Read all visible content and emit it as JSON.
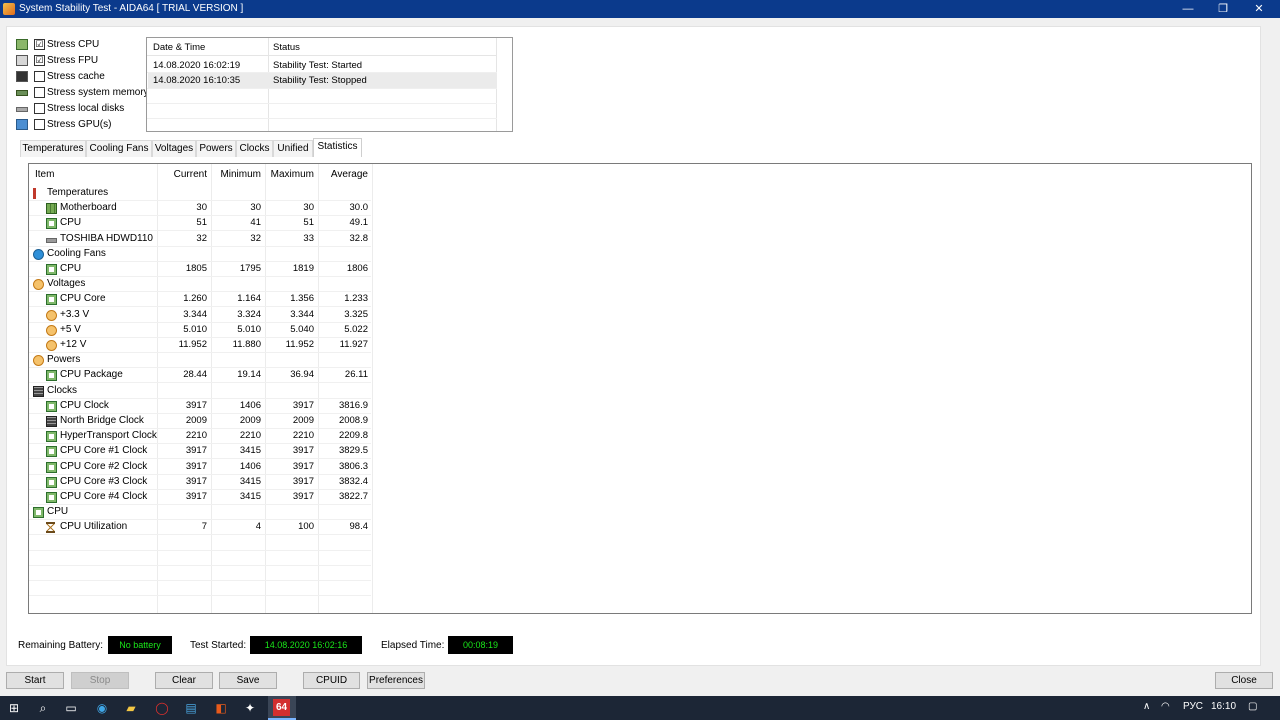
{
  "window": {
    "title": "System Stability Test - AIDA64  [ TRIAL VERSION ]",
    "minimize": "—",
    "maximize": "❐",
    "close": "✕"
  },
  "stress_options": [
    {
      "label": "Stress CPU",
      "checked": "☑",
      "icon": "cpu-chip-icon"
    },
    {
      "label": "Stress FPU",
      "checked": "☑",
      "icon": "fpu-chip-icon"
    },
    {
      "label": "Stress cache",
      "checked": "",
      "icon": "cache-icon"
    },
    {
      "label": "Stress system memory",
      "checked": "",
      "icon": "memory-icon"
    },
    {
      "label": "Stress local disks",
      "checked": "",
      "icon": "disk-icon"
    },
    {
      "label": "Stress GPU(s)",
      "checked": "",
      "icon": "gpu-icon"
    }
  ],
  "log": {
    "headers": [
      "Date & Time",
      "Status"
    ],
    "rows": [
      {
        "time": "14.08.2020 16:02:19",
        "status": "Stability Test: Started"
      },
      {
        "time": "14.08.2020 16:10:35",
        "status": "Stability Test: Stopped"
      }
    ]
  },
  "tabs": [
    "Temperatures",
    "Cooling Fans",
    "Voltages",
    "Powers",
    "Clocks",
    "Unified",
    "Statistics"
  ],
  "statistics": {
    "headers": {
      "item": "Item",
      "current": "Current",
      "minimum": "Minimum",
      "maximum": "Maximum",
      "average": "Average"
    },
    "rows": [
      {
        "label": "Temperatures",
        "group": true,
        "icon": "thermometer-icon"
      },
      {
        "label": "Motherboard",
        "icon": "motherboard-icon",
        "current": "30",
        "minimum": "30",
        "maximum": "30",
        "average": "30.0"
      },
      {
        "label": "CPU",
        "icon": "cpu-icon",
        "current": "51",
        "minimum": "41",
        "maximum": "51",
        "average": "49.1"
      },
      {
        "label": "TOSHIBA HDWD110",
        "icon": "disk-icon",
        "current": "32",
        "minimum": "32",
        "maximum": "33",
        "average": "32.8"
      },
      {
        "label": "Cooling Fans",
        "group": true,
        "icon": "fan-icon"
      },
      {
        "label": "CPU",
        "icon": "cpu-icon",
        "current": "1805",
        "minimum": "1795",
        "maximum": "1819",
        "average": "1806"
      },
      {
        "label": "Voltages",
        "group": true,
        "icon": "voltage-icon"
      },
      {
        "label": "CPU Core",
        "icon": "cpu-icon",
        "current": "1.260",
        "minimum": "1.164",
        "maximum": "1.356",
        "average": "1.233"
      },
      {
        "label": "+3.3 V",
        "icon": "voltage-icon",
        "current": "3.344",
        "minimum": "3.324",
        "maximum": "3.344",
        "average": "3.325"
      },
      {
        "label": "+5 V",
        "icon": "voltage-icon",
        "current": "5.010",
        "minimum": "5.010",
        "maximum": "5.040",
        "average": "5.022"
      },
      {
        "label": "+12 V",
        "icon": "voltage-icon",
        "current": "11.952",
        "minimum": "11.880",
        "maximum": "11.952",
        "average": "11.927"
      },
      {
        "label": "Powers",
        "group": true,
        "icon": "voltage-icon"
      },
      {
        "label": "CPU Package",
        "icon": "cpu-icon",
        "current": "28.44",
        "minimum": "19.14",
        "maximum": "36.94",
        "average": "26.11"
      },
      {
        "label": "Clocks",
        "group": true,
        "icon": "northbridge-icon"
      },
      {
        "label": "CPU Clock",
        "icon": "cpu-icon",
        "current": "3917",
        "minimum": "1406",
        "maximum": "3917",
        "average": "3816.9"
      },
      {
        "label": "North Bridge Clock",
        "icon": "northbridge-icon",
        "current": "2009",
        "minimum": "2009",
        "maximum": "2009",
        "average": "2008.9"
      },
      {
        "label": "HyperTransport Clock",
        "icon": "cpu-icon",
        "current": "2210",
        "minimum": "2210",
        "maximum": "2210",
        "average": "2209.8"
      },
      {
        "label": "CPU Core #1 Clock",
        "icon": "cpu-icon",
        "current": "3917",
        "minimum": "3415",
        "maximum": "3917",
        "average": "3829.5"
      },
      {
        "label": "CPU Core #2 Clock",
        "icon": "cpu-icon",
        "current": "3917",
        "minimum": "1406",
        "maximum": "3917",
        "average": "3806.3"
      },
      {
        "label": "CPU Core #3 Clock",
        "icon": "cpu-icon",
        "current": "3917",
        "minimum": "3415",
        "maximum": "3917",
        "average": "3832.4"
      },
      {
        "label": "CPU Core #4 Clock",
        "icon": "cpu-icon",
        "current": "3917",
        "minimum": "3415",
        "maximum": "3917",
        "average": "3822.7"
      },
      {
        "label": "CPU",
        "group": true,
        "icon": "cpu-icon"
      },
      {
        "label": "CPU Utilization",
        "icon": "hourglass-icon",
        "current": "7",
        "minimum": "4",
        "maximum": "100",
        "average": "98.4"
      }
    ]
  },
  "status": {
    "battery_label": "Remaining Battery:",
    "battery_value": "No battery",
    "started_label": "Test Started:",
    "started_value": "14.08.2020 16:02:16",
    "elapsed_label": "Elapsed Time:",
    "elapsed_value": "00:08:19"
  },
  "buttons": {
    "start": "Start",
    "stop": "Stop",
    "clear": "Clear",
    "save": "Save",
    "cpuid": "CPUID",
    "preferences": "Preferences",
    "close": "Close"
  },
  "taskbar": {
    "active_app": "64",
    "language": "РУС",
    "clock": "16:10"
  }
}
